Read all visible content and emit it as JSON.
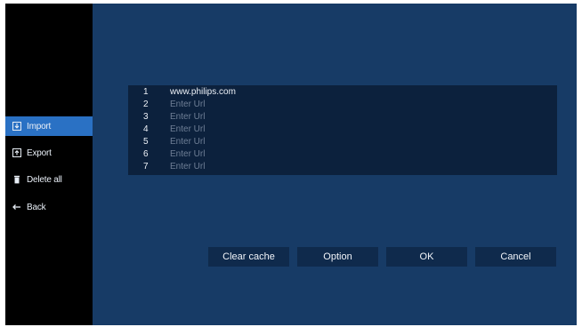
{
  "sidebar": {
    "items": [
      {
        "label": "Import",
        "icon": "import-icon",
        "active": true
      },
      {
        "label": "Export",
        "icon": "export-icon",
        "active": false
      },
      {
        "label": "Delete all",
        "icon": "trash-icon",
        "active": false
      },
      {
        "label": "Back",
        "icon": "back-arrow-icon",
        "active": false
      }
    ]
  },
  "url_list": {
    "rows": [
      {
        "number": "1",
        "value": "www.philips.com",
        "placeholder": ""
      },
      {
        "number": "2",
        "value": "",
        "placeholder": "Enter Url"
      },
      {
        "number": "3",
        "value": "",
        "placeholder": "Enter Url"
      },
      {
        "number": "4",
        "value": "",
        "placeholder": "Enter Url"
      },
      {
        "number": "5",
        "value": "",
        "placeholder": "Enter Url"
      },
      {
        "number": "6",
        "value": "",
        "placeholder": "Enter Url"
      },
      {
        "number": "7",
        "value": "",
        "placeholder": "Enter Url"
      }
    ]
  },
  "buttons": {
    "clear_cache": "Clear cache",
    "option": "Option",
    "ok": "OK",
    "cancel": "Cancel"
  },
  "colors": {
    "background": "#173b66",
    "sidebar": "#000000",
    "active_item": "#2a71c4",
    "panel": "#0c213d",
    "button": "#0f2a4c"
  }
}
